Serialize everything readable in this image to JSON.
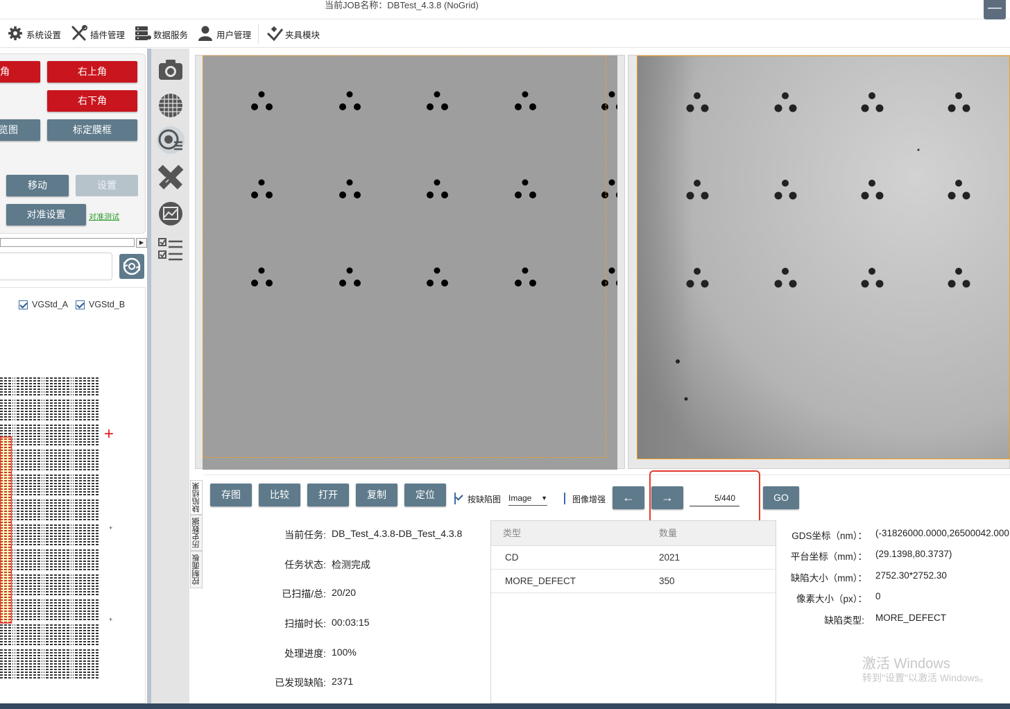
{
  "window": {
    "title": "当前JOB名称：DBTest_4.3.8 (NoGrid)",
    "minimize": "—"
  },
  "menu": {
    "items": [
      {
        "label": "系统设置",
        "icon": "gear-icon"
      },
      {
        "label": "插件管理",
        "icon": "tools-icon"
      },
      {
        "label": "数据服务",
        "icon": "database-icon"
      },
      {
        "label": "用户管理",
        "icon": "user-icon"
      },
      {
        "label": "夹具模块",
        "icon": "fixture-icon"
      }
    ]
  },
  "left_panel": {
    "corner_left_top": "角",
    "corner_right_top": "右上角",
    "corner_right_bottom": "右下角",
    "overview": "览图",
    "calibrate_frame": "标定膜框",
    "move": "移动",
    "settings": "设置",
    "align_settings": "对准设置",
    "align_test": "对准测试",
    "checkboxes": [
      {
        "label": "VGStd_A",
        "checked": true
      },
      {
        "label": "VGStd_B",
        "checked": true
      }
    ]
  },
  "vertical_tabs": [
    "缺陷结果",
    "历史数据",
    "控制面板"
  ],
  "toolbar": {
    "save_image": "存图",
    "compare": "比较",
    "open": "打开",
    "copy": "复制",
    "locate": "定位",
    "by_defect_label": "按缺陷图",
    "by_defect_checked": true,
    "image_select": "Image",
    "enhance_label": "图像增强",
    "enhance_checked": false,
    "prev": "←",
    "next": "→",
    "page": "5/440",
    "go": "GO"
  },
  "task_info": {
    "current_task_label": "当前任务:",
    "current_task": "DB_Test_4.3.8-DB_Test_4.3.8",
    "status_label": "任务状态:",
    "status": "检测完成",
    "scanned_label": "已扫描/总:",
    "scanned": "20/20",
    "duration_label": "扫描时长:",
    "duration": "00:03:15",
    "progress_label": "处理进度:",
    "progress": "100%",
    "defects_label": "已发现缺陷:",
    "defects": "2371"
  },
  "defect_table": {
    "headers": [
      "类型",
      "数量"
    ],
    "rows": [
      {
        "type": "CD",
        "count": "2021"
      },
      {
        "type": "MORE_DEFECT",
        "count": "350"
      }
    ]
  },
  "coords": {
    "gds_label": "GDS坐标（nm）：",
    "gds": "(-31826000.0000,26500042.000",
    "platform_label": "平台坐标（mm）：",
    "platform": "(29.1398,80.3737)",
    "defect_size_label": "缺陷大小（mm）：",
    "defect_size": "2752.30*2752.30",
    "pixel_size_label": "像素大小（px）：",
    "pixel_size": "0",
    "defect_type_label": "缺陷类型:",
    "defect_type": "MORE_DEFECT"
  },
  "watermark": {
    "line1": "激活 Windows",
    "line2": "转到\"设置\"以激活 Windows。"
  },
  "colors": {
    "slate_button": "#5e7a8b",
    "red_button": "#c9151e",
    "highlight": "#e23a2a",
    "orange_frame": "#f0a020"
  }
}
